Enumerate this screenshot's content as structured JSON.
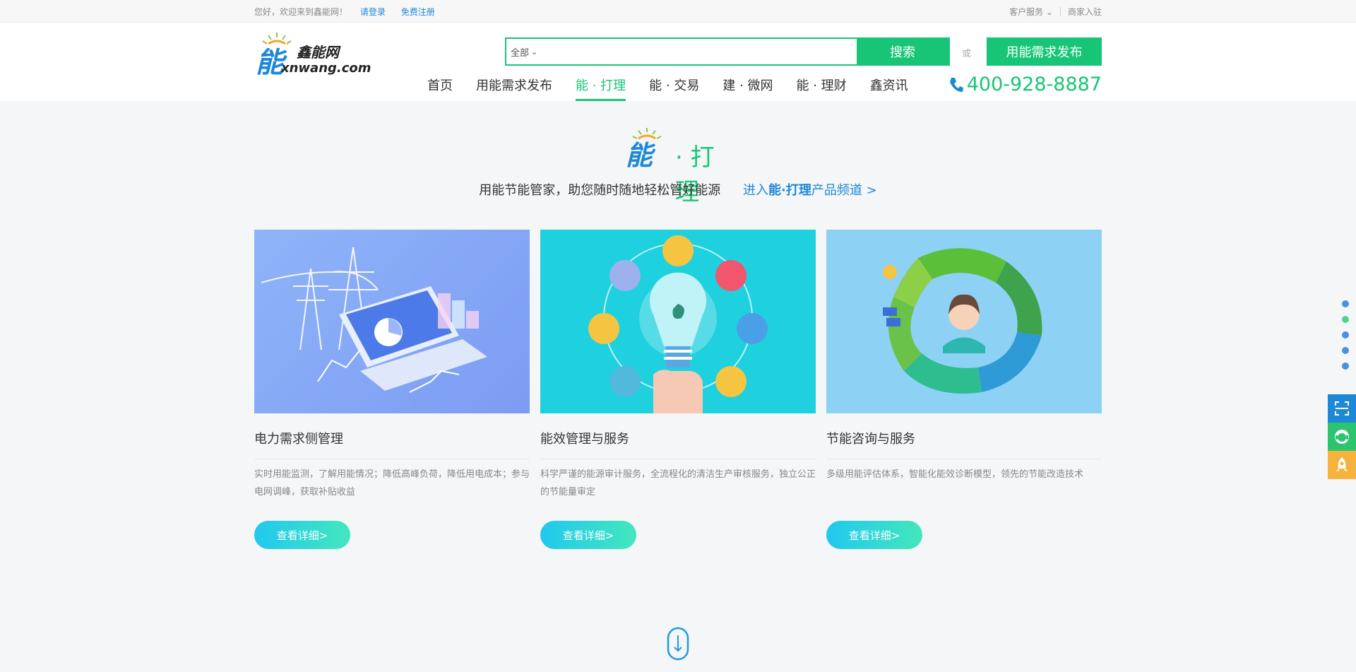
{
  "topbar": {
    "welcome": "您好，欢迎来到鑫能网！",
    "login": "请登录",
    "register": "免费注册",
    "service": "客户服务",
    "merchant": "商家入驻"
  },
  "header": {
    "brand": "鑫能网",
    "domain": "xnwang.com",
    "search_category": "全部",
    "search_placeholder": "",
    "search_button": "搜索",
    "or": "或",
    "publish_button": "用能需求发布",
    "phone": "400-928-8887",
    "nav": [
      {
        "label": "首页"
      },
      {
        "label": "用能需求发布"
      },
      {
        "label": "能 · 打理"
      },
      {
        "label": "能 · 交易"
      },
      {
        "label": "建 · 微网"
      },
      {
        "label": "能 · 理财"
      },
      {
        "label": "鑫资讯"
      }
    ]
  },
  "section": {
    "title": "· 打理",
    "tagline": "用能节能管家，助您随时随地轻松管好能源",
    "link_pre": "进入",
    "link_bold": "能·打理",
    "link_post": "产品频道 >"
  },
  "cards": [
    {
      "title": "电力需求侧管理",
      "desc": "实时用能监测，了解用能情况；降低高峰负荷，降低用电成本；参与电网调峰，获取补贴收益",
      "button": "查看详细>"
    },
    {
      "title": "能效管理与服务",
      "desc": "科学严谨的能源审计服务，全流程化的清洁生产审核服务，独立公正的节能量审定",
      "button": "查看详细>"
    },
    {
      "title": "节能咨询与服务",
      "desc": "多级用能评估体系，智能化能效诊断模型，领先的节能改造技术",
      "button": "查看详细>"
    }
  ],
  "colors": {
    "accent": "#18c576",
    "link": "#1e88d8",
    "blue_btn": "#1e88d8",
    "green_btn": "#2cc46e",
    "orange_btn": "#f5b33d"
  }
}
